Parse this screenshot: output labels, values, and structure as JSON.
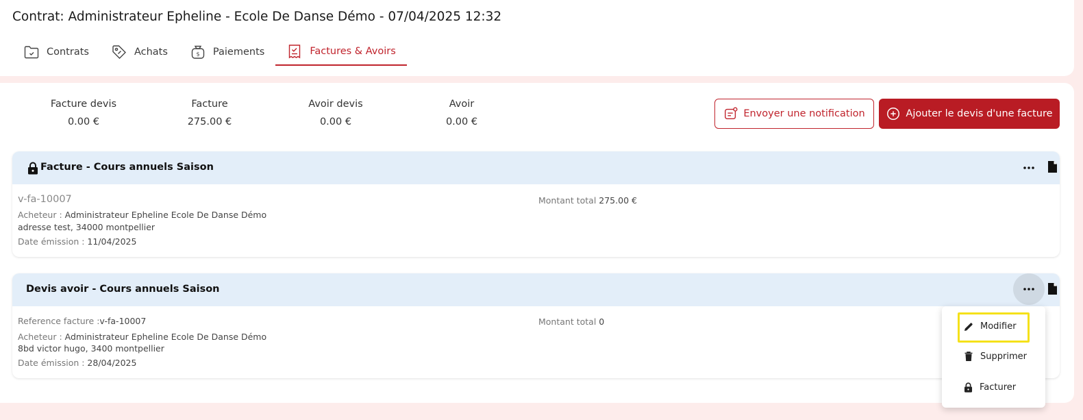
{
  "header": {
    "title": "Contrat: Administrateur Epheline - Ecole De Danse Démo - 07/04/2025 12:32",
    "tabs": [
      {
        "label": "Contrats",
        "icon": "folder-check-icon"
      },
      {
        "label": "Achats",
        "icon": "tag-icon"
      },
      {
        "label": "Paiements",
        "icon": "money-bag-icon"
      },
      {
        "label": "Factures & Avoirs",
        "icon": "invoice-check-icon",
        "active": true
      }
    ]
  },
  "stats": [
    {
      "label": "Facture devis",
      "value": "0.00 €"
    },
    {
      "label": "Facture",
      "value": "275.00 €"
    },
    {
      "label": "Avoir devis",
      "value": "0.00 €"
    },
    {
      "label": "Avoir",
      "value": "0.00 €"
    }
  ],
  "actions": {
    "notify_label": "Envoyer une notification",
    "add_label": "Ajouter le devis d'une facture"
  },
  "documents": [
    {
      "title": "Facture - Cours annuels Saison",
      "locked": true,
      "reference": "v-fa-10007",
      "buyer_label": "Acheteur : ",
      "buyer": "Administrateur Epheline Ecole De Danse Démo",
      "address": "adresse test, 34000 montpellier",
      "date_label": "Date émission : ",
      "date": "11/04/2025",
      "total_label": "Montant total ",
      "total": "275.00 €"
    },
    {
      "title": "Devis avoir - Cours annuels Saison",
      "locked": false,
      "reference_label": "Reference facture :",
      "reference": "v-fa-10007",
      "buyer_label": "Acheteur : ",
      "buyer": "Administrateur Epheline Ecole De Danse Démo",
      "address": "8bd victor hugo, 3400 montpellier",
      "date_label": "Date émission : ",
      "date": "28/04/2025",
      "total_label": "Montant total ",
      "total": "0"
    }
  ],
  "menu": {
    "items": [
      {
        "label": "Modifier",
        "icon": "pencil-icon",
        "highlighted": true
      },
      {
        "label": "Supprimer",
        "icon": "trash-icon"
      },
      {
        "label": "Facturer",
        "icon": "lock-icon"
      }
    ]
  },
  "colors": {
    "accent": "#c0232c",
    "accent_dark": "#b91c24",
    "doc_header_bg": "#e3eef9",
    "page_bg": "#fdeceb",
    "highlight": "#f5e11a"
  }
}
